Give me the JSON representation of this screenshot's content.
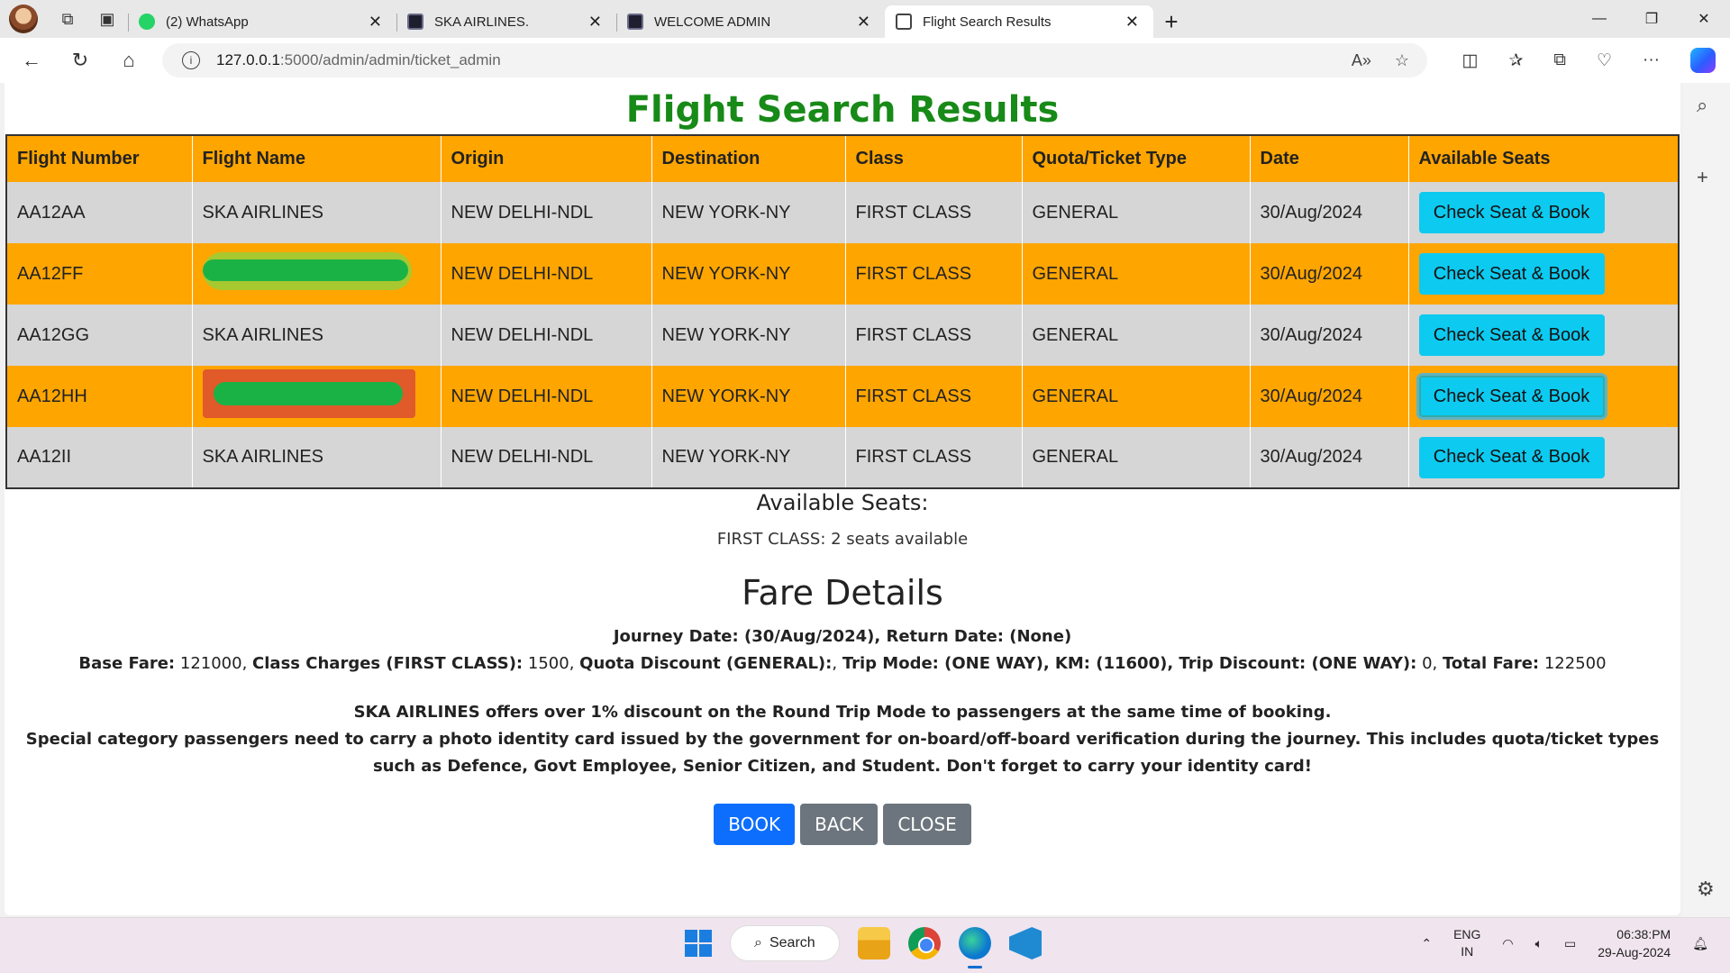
{
  "browser": {
    "tabs": [
      {
        "title": "(2) WhatsApp",
        "favicon": "whatsapp-icon"
      },
      {
        "title": "SKA AIRLINES.",
        "favicon": "terminal-icon"
      },
      {
        "title": "WELCOME ADMIN",
        "favicon": "terminal-icon"
      },
      {
        "title": "Flight Search Results",
        "favicon": "page-icon",
        "active": true
      }
    ],
    "url_host": "127.0.0.1",
    "url_path": ":5000/admin/admin/ticket_admin"
  },
  "page": {
    "title": "Flight Search Results",
    "title_color": "#178a17",
    "table": {
      "headers": [
        "Flight Number",
        "Flight Name",
        "Origin",
        "Destination",
        "Class",
        "Quota/Ticket Type",
        "Date",
        "Available Seats"
      ],
      "rows": [
        {
          "flight_number": "AA12AA",
          "flight_name": "SKA AIRLINES",
          "origin": "NEW DELHI-NDL",
          "destination": "NEW YORK-NY",
          "class": "FIRST CLASS",
          "quota": "GENERAL",
          "date": "30/Aug/2024",
          "action": "Check Seat & Book"
        },
        {
          "flight_number": "AA12FF",
          "flight_name": "",
          "origin": "NEW DELHI-NDL",
          "destination": "NEW YORK-NY",
          "class": "FIRST CLASS",
          "quota": "GENERAL",
          "date": "30/Aug/2024",
          "action": "Check Seat & Book"
        },
        {
          "flight_number": "AA12GG",
          "flight_name": "SKA AIRLINES",
          "origin": "NEW DELHI-NDL",
          "destination": "NEW YORK-NY",
          "class": "FIRST CLASS",
          "quota": "GENERAL",
          "date": "30/Aug/2024",
          "action": "Check Seat & Book"
        },
        {
          "flight_number": "AA12HH",
          "flight_name": "",
          "origin": "NEW DELHI-NDL",
          "destination": "NEW YORK-NY",
          "class": "FIRST CLASS",
          "quota": "GENERAL",
          "date": "30/Aug/2024",
          "action": "Check Seat & Book"
        },
        {
          "flight_number": "AA12II",
          "flight_name": "SKA AIRLINES",
          "origin": "NEW DELHI-NDL",
          "destination": "NEW YORK-NY",
          "class": "FIRST CLASS",
          "quota": "GENERAL",
          "date": "30/Aug/2024",
          "action": "Check Seat & Book"
        }
      ]
    },
    "available_seats": {
      "heading": "Available Seats:",
      "line": "FIRST CLASS: 2 seats available"
    },
    "fare": {
      "heading": "Fare Details",
      "journey_line": "Journey Date: (30/Aug/2024), Return Date: (None)",
      "base_fare_label": "Base Fare:",
      "base_fare_value": "121000",
      "class_charges_label": "Class Charges (FIRST CLASS):",
      "class_charges_value": "1500",
      "quota_discount_label": "Quota Discount (GENERAL):",
      "quota_discount_value": ", ",
      "trip_mode_label": "Trip Mode: (ONE WAY), KM: (11600), Trip Discount: (ONE WAY):",
      "trip_discount_value": "0",
      "total_fare_label": "Total Fare:",
      "total_fare_value": "122500"
    },
    "notes": {
      "line1": "SKA AIRLINES offers over 1% discount on the Round Trip Mode to passengers at the same time of booking.",
      "line2": "Special category passengers need to carry a photo identity card issued by the government for on-board/off-board verification during the journey. This includes quota/ticket types such as Defence, Govt Employee, Senior Citizen, and Student. Don't forget to carry your identity card!"
    },
    "buttons": {
      "book": "BOOK",
      "back": "BACK",
      "close": "CLOSE"
    }
  },
  "taskbar": {
    "search_label": "Search",
    "lang_top": "ENG",
    "lang_bottom": "IN",
    "time": "06:38:PM",
    "date": "29-Aug-2024"
  },
  "colors": {
    "header_orange": "#ffa500",
    "row_gray": "#d6d6d6",
    "cyan_button": "#0dcaf0",
    "book_blue": "#0d6efd",
    "gray_button": "#6c757d"
  }
}
